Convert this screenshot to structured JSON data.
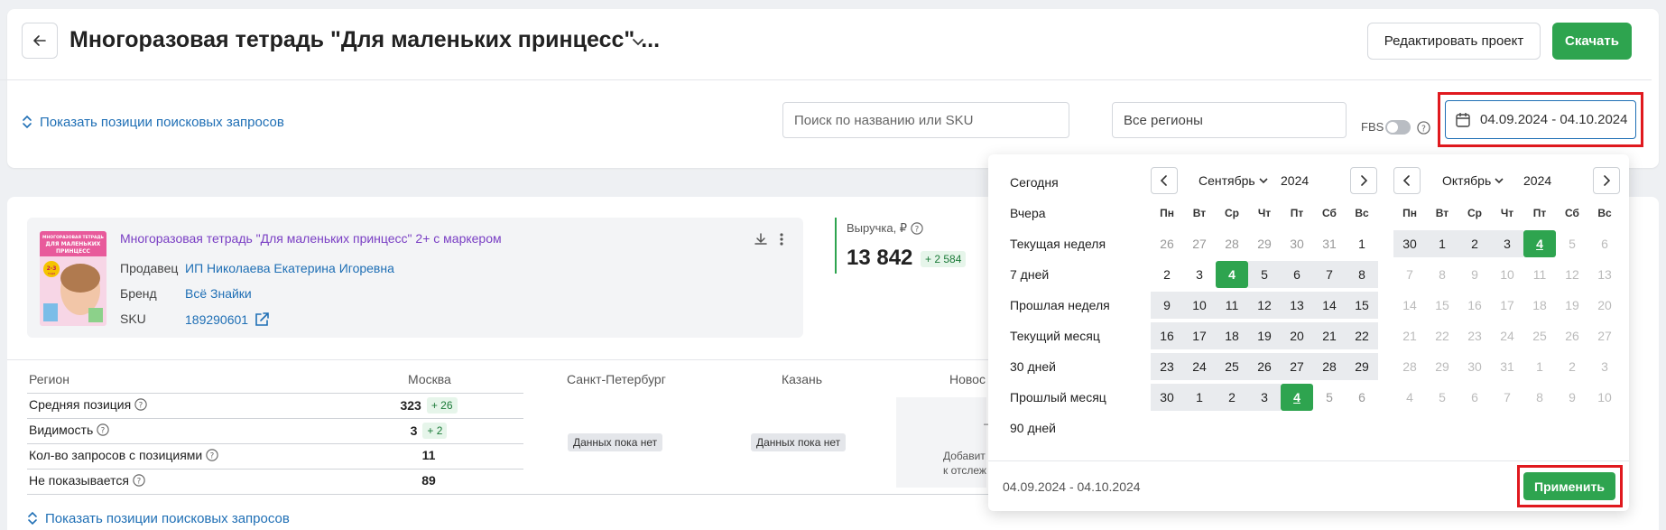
{
  "header": {
    "title": "Многоразовая тетрадь \"Для маленьких принцесс\" ...",
    "edit_label": "Редактировать проект",
    "download_label": "Скачать"
  },
  "filters": {
    "show_positions_label": "Показать позиции поисковых запросов",
    "search_placeholder": "Поиск по названию или SKU",
    "region_value": "Все регионы",
    "fbs_label": "FBS",
    "date_range": "04.09.2024 - 04.10.2024"
  },
  "product": {
    "name": "Многоразовая тетрадь \"Для маленьких принцесс\" 2+ с маркером",
    "seller_label": "Продавец",
    "seller_value": "ИП Николаева Екатерина Игоревна",
    "brand_label": "Бренд",
    "brand_value": "Всё Знайки",
    "sku_label": "SKU",
    "sku_value": "189290601",
    "cover_title_line1": "МНОГОРАЗОВАЯ ТЕТРАДЬ",
    "cover_title_line2": "ДЛЯ МАЛЕНЬКИХ",
    "cover_title_line3": "ПРИНЦЕСС",
    "cover_age": "2-3",
    "cover_age_sub": "года"
  },
  "revenue": {
    "label": "Выручка, ₽",
    "value": "13 842",
    "delta": "+ 2 584"
  },
  "table": {
    "region_header": "Регион",
    "columns": [
      "Москва",
      "Санкт-Петербург",
      "Казань",
      "Новос"
    ],
    "rows": [
      {
        "label": "Средняя позиция",
        "value": "323",
        "delta": "+ 26"
      },
      {
        "label": "Видимость",
        "value": "3",
        "delta": "+ 2"
      },
      {
        "label": "Кол-во запросов с позициями",
        "value": "11",
        "delta": ""
      },
      {
        "label": "Не показывается",
        "value": "89",
        "delta": ""
      }
    ],
    "no_data": "Данных пока нет",
    "novos_dash": "–",
    "novos_line1": "Добавит",
    "novos_line2": "к отслеж"
  },
  "picker": {
    "presets": [
      "Сегодня",
      "Вчера",
      "Текущая неделя",
      "7 дней",
      "Прошлая неделя",
      "Текущий месяц",
      "30 дней",
      "Прошлый месяц",
      "90 дней"
    ],
    "weekdays": [
      "Пн",
      "Вт",
      "Ср",
      "Чт",
      "Пт",
      "Сб",
      "Вс"
    ],
    "left": {
      "month": "Сентябрь",
      "year": "2024",
      "days": [
        {
          "n": "26",
          "s": "out"
        },
        {
          "n": "27",
          "s": "out"
        },
        {
          "n": "28",
          "s": "out"
        },
        {
          "n": "29",
          "s": "out"
        },
        {
          "n": "30",
          "s": "out"
        },
        {
          "n": "31",
          "s": "out"
        },
        {
          "n": "1",
          "s": ""
        },
        {
          "n": "2",
          "s": ""
        },
        {
          "n": "3",
          "s": ""
        },
        {
          "n": "4",
          "s": "sel"
        },
        {
          "n": "5",
          "s": "range"
        },
        {
          "n": "6",
          "s": "range"
        },
        {
          "n": "7",
          "s": "range"
        },
        {
          "n": "8",
          "s": "range"
        },
        {
          "n": "9",
          "s": "range"
        },
        {
          "n": "10",
          "s": "range"
        },
        {
          "n": "11",
          "s": "range"
        },
        {
          "n": "12",
          "s": "range"
        },
        {
          "n": "13",
          "s": "range"
        },
        {
          "n": "14",
          "s": "range"
        },
        {
          "n": "15",
          "s": "range"
        },
        {
          "n": "16",
          "s": "range"
        },
        {
          "n": "17",
          "s": "range"
        },
        {
          "n": "18",
          "s": "range"
        },
        {
          "n": "19",
          "s": "range"
        },
        {
          "n": "20",
          "s": "range"
        },
        {
          "n": "21",
          "s": "range"
        },
        {
          "n": "22",
          "s": "range"
        },
        {
          "n": "23",
          "s": "range"
        },
        {
          "n": "24",
          "s": "range"
        },
        {
          "n": "25",
          "s": "range"
        },
        {
          "n": "26",
          "s": "range"
        },
        {
          "n": "27",
          "s": "range"
        },
        {
          "n": "28",
          "s": "range"
        },
        {
          "n": "29",
          "s": "range"
        },
        {
          "n": "30",
          "s": "range"
        },
        {
          "n": "1",
          "s": "range"
        },
        {
          "n": "2",
          "s": "range"
        },
        {
          "n": "3",
          "s": "range"
        },
        {
          "n": "4",
          "s": "sel today"
        },
        {
          "n": "5",
          "s": "out"
        },
        {
          "n": "6",
          "s": "out"
        }
      ]
    },
    "right": {
      "month": "Октябрь",
      "year": "2024",
      "days": [
        {
          "n": "30",
          "s": "range"
        },
        {
          "n": "1",
          "s": "range"
        },
        {
          "n": "2",
          "s": "range"
        },
        {
          "n": "3",
          "s": "range"
        },
        {
          "n": "4",
          "s": "sel today"
        },
        {
          "n": "5",
          "s": "dis"
        },
        {
          "n": "6",
          "s": "dis"
        },
        {
          "n": "7",
          "s": "dis"
        },
        {
          "n": "8",
          "s": "dis"
        },
        {
          "n": "9",
          "s": "dis"
        },
        {
          "n": "10",
          "s": "dis"
        },
        {
          "n": "11",
          "s": "dis"
        },
        {
          "n": "12",
          "s": "dis"
        },
        {
          "n": "13",
          "s": "dis"
        },
        {
          "n": "14",
          "s": "dis"
        },
        {
          "n": "15",
          "s": "dis"
        },
        {
          "n": "16",
          "s": "dis"
        },
        {
          "n": "17",
          "s": "dis"
        },
        {
          "n": "18",
          "s": "dis"
        },
        {
          "n": "19",
          "s": "dis"
        },
        {
          "n": "20",
          "s": "dis"
        },
        {
          "n": "21",
          "s": "dis"
        },
        {
          "n": "22",
          "s": "dis"
        },
        {
          "n": "23",
          "s": "dis"
        },
        {
          "n": "24",
          "s": "dis"
        },
        {
          "n": "25",
          "s": "dis"
        },
        {
          "n": "26",
          "s": "dis"
        },
        {
          "n": "27",
          "s": "dis"
        },
        {
          "n": "28",
          "s": "dis"
        },
        {
          "n": "29",
          "s": "dis"
        },
        {
          "n": "30",
          "s": "dis"
        },
        {
          "n": "31",
          "s": "dis"
        },
        {
          "n": "1",
          "s": "dis"
        },
        {
          "n": "2",
          "s": "dis"
        },
        {
          "n": "3",
          "s": "dis"
        },
        {
          "n": "4",
          "s": "dis"
        },
        {
          "n": "5",
          "s": "dis"
        },
        {
          "n": "6",
          "s": "dis"
        },
        {
          "n": "7",
          "s": "dis"
        },
        {
          "n": "8",
          "s": "dis"
        },
        {
          "n": "9",
          "s": "dis"
        },
        {
          "n": "10",
          "s": "dis"
        }
      ]
    },
    "range_text": "04.09.2024 - 04.10.2024",
    "apply_label": "Применить"
  },
  "colors": {
    "accent_green": "#2ea44f",
    "link_blue": "#1f6fb5",
    "highlight_red": "#e0191e",
    "product_purple": "#7a3fc4"
  }
}
